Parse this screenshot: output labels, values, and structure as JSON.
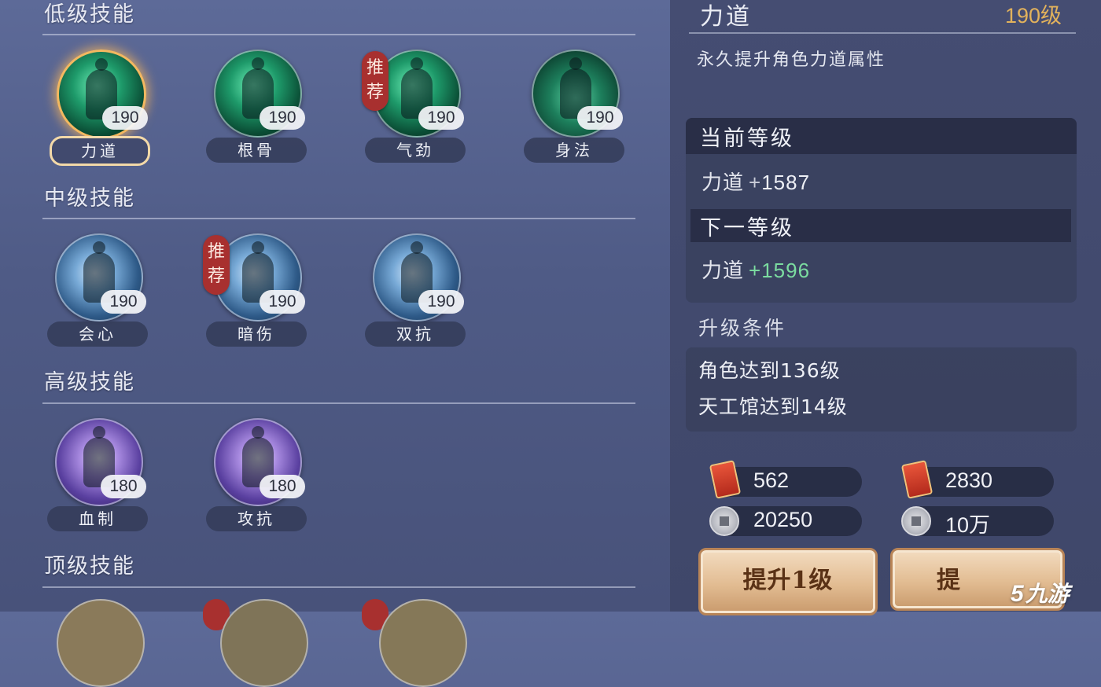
{
  "sections": {
    "low": "低级技能",
    "mid": "中级技能",
    "high": "高级技能",
    "top": "顶级技能"
  },
  "skills": {
    "low": [
      {
        "name": "力道",
        "level": "190",
        "selected": true,
        "icon": "martial-pose-icon",
        "color": "green"
      },
      {
        "name": "根骨",
        "level": "190",
        "icon": "vine-figure-icon",
        "color": "green"
      },
      {
        "name": "气劲",
        "level": "190",
        "badge": "推荐",
        "icon": "fist-icon",
        "color": "green"
      },
      {
        "name": "身法",
        "level": "190",
        "icon": "monk-figure-icon",
        "color": "teal"
      }
    ],
    "mid": [
      {
        "name": "会心",
        "level": "190",
        "icon": "strike-fist-icon",
        "color": "blue"
      },
      {
        "name": "暗伤",
        "level": "190",
        "badge": "推荐",
        "icon": "blade-icon",
        "color": "blue"
      },
      {
        "name": "双抗",
        "level": "190",
        "icon": "glow-figure-icon",
        "color": "blue"
      }
    ],
    "high": [
      {
        "name": "血制",
        "level": "180",
        "icon": "purple-aura-icon",
        "color": "purple"
      },
      {
        "name": "攻抗",
        "level": "180",
        "icon": "purple-warrior-icon",
        "color": "purple"
      }
    ]
  },
  "detail": {
    "title": "力道",
    "level": "190级",
    "description": "永久提升角色力道属性",
    "current_header": "当前等级",
    "current_stat": "力道",
    "current_plus": "+",
    "current_value": "1587",
    "next_header": "下一等级",
    "next_stat": "力道",
    "next_plus": "+",
    "next_value": "1596",
    "next_color": "#7bdca0"
  },
  "conditions": {
    "title": "升级条件",
    "lines": [
      "角色达到136级",
      "天工馆达到14级"
    ]
  },
  "resources": {
    "left_token": "562",
    "left_coin": "20250",
    "right_token": "2830",
    "right_coin": "10万",
    "token_icon": "red-token-icon",
    "coin_icon": "silver-coin-icon"
  },
  "buttons": {
    "upgrade_one": "提升1级",
    "upgrade_more": "提"
  },
  "watermark": {
    "mark": "5",
    "text": "九游"
  },
  "colors": {
    "accent_gold": "#e2b25c",
    "badge_red": "#a8302f",
    "selected_glow": "#f3b860"
  }
}
